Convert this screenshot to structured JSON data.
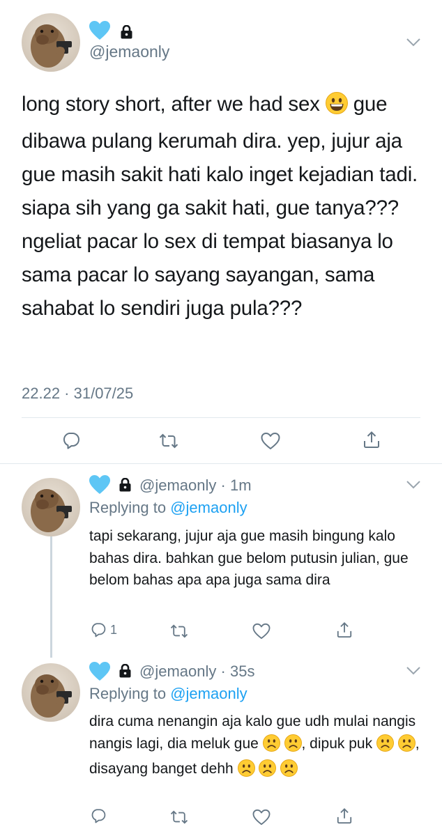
{
  "tweet": {
    "handle": "@jemaonly",
    "text_parts": [
      "long story short, after we had sex ",
      " gue dibawa pulang kerumah dira. yep, jujur aja gue masih sakit hati kalo inget kejadian tadi. siapa sih yang ga sakit hati, gue tanya??? ngeliat pacar lo sex di tempat biasanya lo sama pacar lo sayang sayangan, sama sahabat lo sendiri juga pula???"
    ],
    "timestamp": "22.22 · 31/07/25",
    "emoji": "grinning-face"
  },
  "replies": [
    {
      "handle": "@jemaonly",
      "time": "1m",
      "replying_prefix": "Replying to",
      "replying_to": "@jemaonly",
      "text": "tapi sekarang, jujur aja gue masih bingung kalo bahas dira. bahkan gue belom putusin julian, gue belom bahas apa apa juga sama dira",
      "reply_count": "1"
    },
    {
      "handle": "@jemaonly",
      "time": "35s",
      "replying_prefix": "Replying to",
      "replying_to": "@jemaonly",
      "text_parts": [
        "dira cuma nenangin aja kalo gue udh mulai nangis nangis lagi, dia meluk gue ",
        ", dipuk puk ",
        ",  disayang banget dehh "
      ],
      "reply_count": ""
    }
  ],
  "colors": {
    "text": "#14171a",
    "muted": "#657786",
    "link": "#1da1f2",
    "divider": "#e1e8ed",
    "heart": "#5ec6f5"
  },
  "separator": "·",
  "icons": [
    "light-blue-heart-icon",
    "lock-icon",
    "chevron-down-icon",
    "reply-icon",
    "retweet-icon",
    "like-icon",
    "share-icon",
    "frowning-face-emoji",
    "grinning-face-emoji"
  ]
}
